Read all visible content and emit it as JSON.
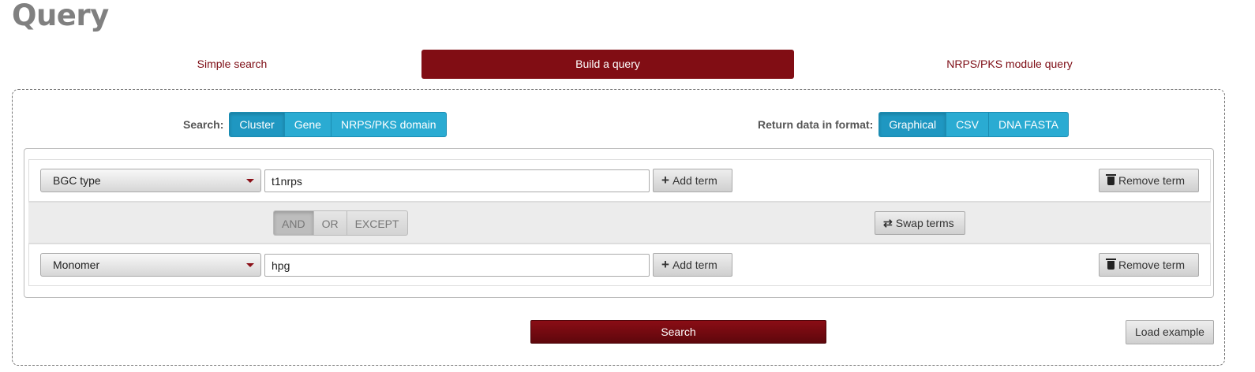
{
  "page": {
    "title": "Query"
  },
  "tabs": [
    {
      "label": "Simple search",
      "active": false
    },
    {
      "label": "Build a query",
      "active": true
    },
    {
      "label": "NRPS/PKS module query",
      "active": false
    }
  ],
  "search": {
    "label": "Search:",
    "options": [
      "Cluster",
      "Gene",
      "NRPS/PKS domain"
    ],
    "selected": "Cluster"
  },
  "format": {
    "label": "Return data in format:",
    "options": [
      "Graphical",
      "CSV",
      "DNA FASTA"
    ],
    "selected": "Graphical"
  },
  "terms": [
    {
      "category": "BGC type",
      "value": "t1nrps",
      "add_label": "Add term",
      "remove_label": "Remove term"
    },
    {
      "category": "Monomer",
      "value": "hpg",
      "add_label": "Add term",
      "remove_label": "Remove term"
    }
  ],
  "operators": {
    "options": [
      "AND",
      "OR",
      "EXCEPT"
    ],
    "selected": "AND",
    "swap_label": "Swap terms"
  },
  "actions": {
    "search_label": "Search",
    "example_label": "Load example"
  },
  "colors": {
    "brand": "#810d14",
    "accent": "#2aabd2"
  }
}
